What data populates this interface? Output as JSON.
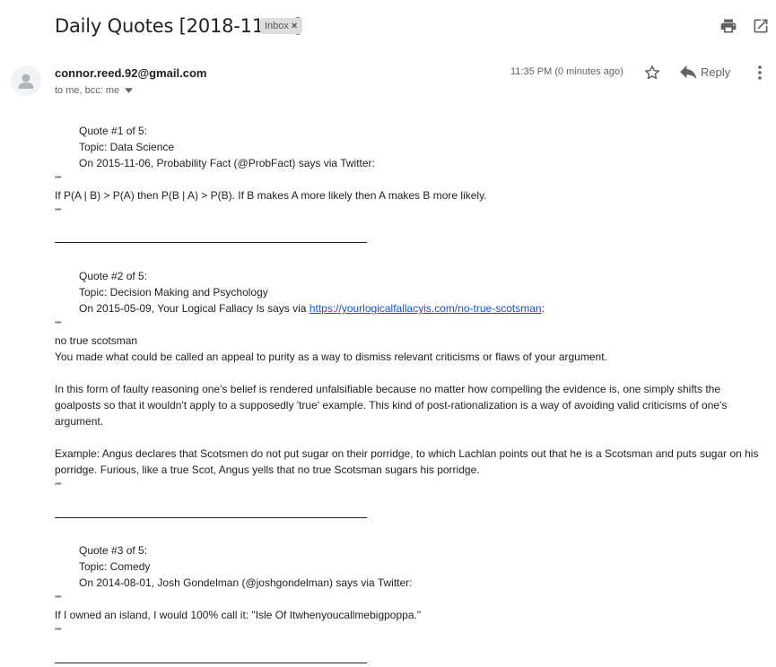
{
  "header": {
    "subject": "Daily Quotes [2018-11-26]",
    "label": "Inbox",
    "label_close": "×",
    "icons": [
      "print-icon",
      "open-in-new-window-icon"
    ]
  },
  "message": {
    "sender": "connor.reed.92@gmail.com",
    "recipients": "to me, bcc: me",
    "time": "11:35 PM (0 minutes ago)",
    "reply_label": "Reply",
    "icons": [
      "avatar-person-icon",
      "star-icon",
      "reply-icon",
      "more-vertical-icon",
      "chevron-down-icon"
    ]
  },
  "body": {
    "quote_mark": "\"\"\"",
    "divider": "————————————————————————",
    "quotes": [
      {
        "header": "Quote #1 of 5:",
        "topic": "Topic: Data Science",
        "source": "On 2015-11-06, Probability Fact (@ProbFact) says via Twitter:",
        "lines": [
          "If P(A | B) > P(A) then P(B | A) > P(B). If B makes A more likely then A makes B more likely."
        ]
      },
      {
        "header": "Quote #2 of 5:",
        "topic": "Topic: Decision Making and Psychology",
        "source_prefix": "On 2015-05-09, Your Logical Fallacy Is says via ",
        "source_link": "https://yourlogicalfallacyis.com/no-true-scotsman",
        "source_suffix": ":",
        "lines": [
          "no true scotsman",
          "You made what could be called an appeal to purity as a way to dismiss relevant criticisms or flaws of your argument.",
          "In this form of faulty reasoning one's belief is rendered unfalsifiable because no matter how compelling the evidence is, one simply shifts the",
          "goalposts so that it wouldn't apply to a supposedly 'true' example. This kind of post-rationalization is a way of avoiding valid criticisms of one's",
          "argument.",
          "Example: Angus declares that Scotsmen do not put sugar on their porridge, to which Lachlan points out that he is a Scotsman and puts sugar on his",
          "porridge. Furious, like a true Scot, Angus yells that no true Scotsman sugars his porridge."
        ]
      },
      {
        "header": "Quote #3 of 5:",
        "topic": "Topic: Comedy",
        "source": "On 2014-08-01, Josh Gondelman (@joshgondelman) says via Twitter:",
        "lines": [
          "If I owned an island, I would 100% call it: \"Isle Of Itwhenyoucallmebigpoppa.\""
        ]
      }
    ]
  },
  "colors": {
    "link": "#1155cc",
    "badge_bg": "#dddddd",
    "icon_gray": "#5f6368",
    "text": "#222222"
  }
}
